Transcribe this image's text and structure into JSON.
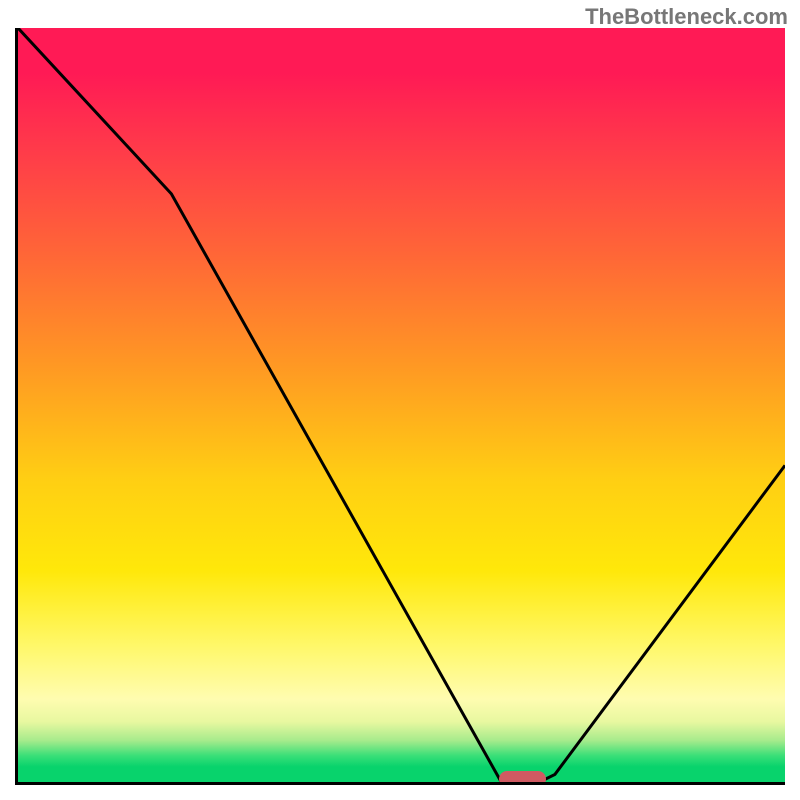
{
  "watermark": "TheBottleneck.com",
  "chart_data": {
    "type": "line",
    "title": "",
    "xlabel": "",
    "ylabel": "",
    "xlim": [
      0,
      100
    ],
    "ylim": [
      0,
      100
    ],
    "x": [
      0,
      20,
      63,
      68,
      70,
      100
    ],
    "values": [
      100,
      78,
      0,
      0,
      1,
      42
    ],
    "optimal_marker": {
      "x_start": 63,
      "x_end": 68,
      "y": 0
    }
  },
  "colors": {
    "gradient_top": "#ff1a55",
    "gradient_mid": "#ffcf13",
    "gradient_bottom": "#08d36c",
    "marker": "#d05a62",
    "line": "#000000"
  }
}
